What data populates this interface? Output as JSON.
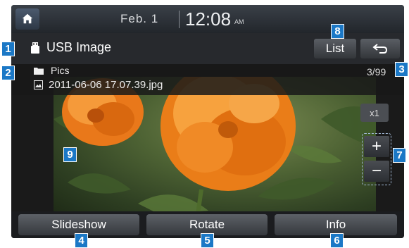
{
  "topbar": {
    "date": "Feb.  1",
    "time": "12:08",
    "ampm": "AM"
  },
  "header": {
    "title": "USB Image",
    "list_label": "List"
  },
  "file_info": {
    "folder": "Pics",
    "filename": "2011-06-06 17.07.39.jpg",
    "counter": "3/99"
  },
  "zoom": {
    "level": "x1",
    "plus": "+",
    "minus": "−"
  },
  "bottombar": {
    "slideshow": "Slideshow",
    "rotate": "Rotate",
    "info": "Info"
  },
  "callouts": [
    "1",
    "2",
    "3",
    "4",
    "5",
    "6",
    "7",
    "8",
    "9"
  ],
  "colors": {
    "callout": "#1b78c6",
    "flower": "#f08a1e"
  }
}
